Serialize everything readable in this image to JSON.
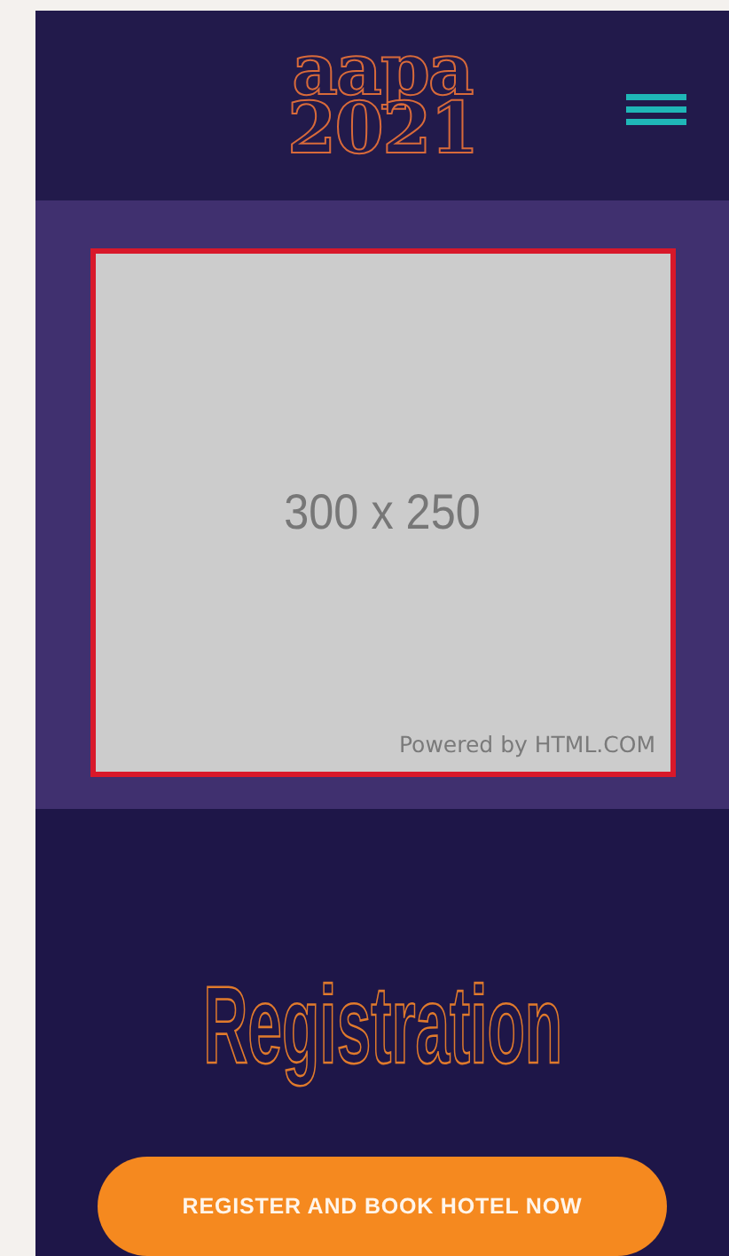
{
  "header": {
    "logo_lines": [
      "aapa",
      "2021"
    ]
  },
  "ad": {
    "size_text": "300 x 250",
    "credit": "Powered by HTML.COM"
  },
  "section": {
    "title": "Registration"
  },
  "button": {
    "label": "REGISTER AND BOOK HOTEL NOW"
  }
}
